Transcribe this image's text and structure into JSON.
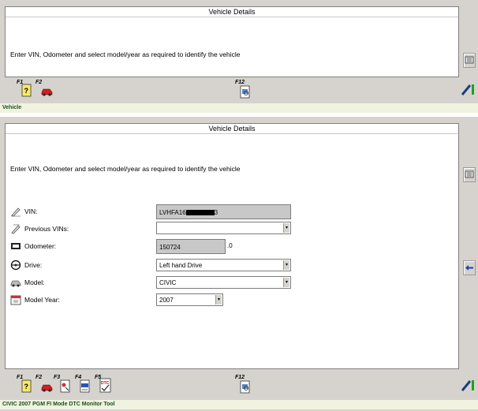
{
  "top_panel": {
    "title": "Vehicle Details",
    "instruction": "Enter VIN, Odometer and select model/year as required to identify the vehicle",
    "fkeys": {
      "f1": "F1",
      "f2": "F2",
      "f12": "F12"
    }
  },
  "top_status": "Vehicle",
  "main_panel": {
    "title": "Vehicle Details",
    "instruction": "Enter VIN, Odometer and select model/year as required to identify the vehicle",
    "fields": {
      "vin": {
        "label": "VIN:",
        "value_prefix": "LVHFA16",
        "value_suffix": "3"
      },
      "previous_vins": {
        "label": "Previous VINs:",
        "value": ""
      },
      "odometer": {
        "label": "Odometer:",
        "value": "150724",
        "suffix": ".0"
      },
      "drive": {
        "label": "Drive:",
        "value": "Left hand Drive"
      },
      "model": {
        "label": "Model:",
        "value": "CIVIC"
      },
      "model_year": {
        "label": "Model Year:",
        "value": "2007"
      }
    },
    "fkeys": {
      "f1": "F1",
      "f2": "F2",
      "f3": "F3",
      "f4": "F4",
      "f5": "F5",
      "f12": "F12"
    },
    "dtc_label": "DTC"
  },
  "bottom_status": "CIVIC 2007  PGM FI  Mode  DTC Monitor Tool"
}
